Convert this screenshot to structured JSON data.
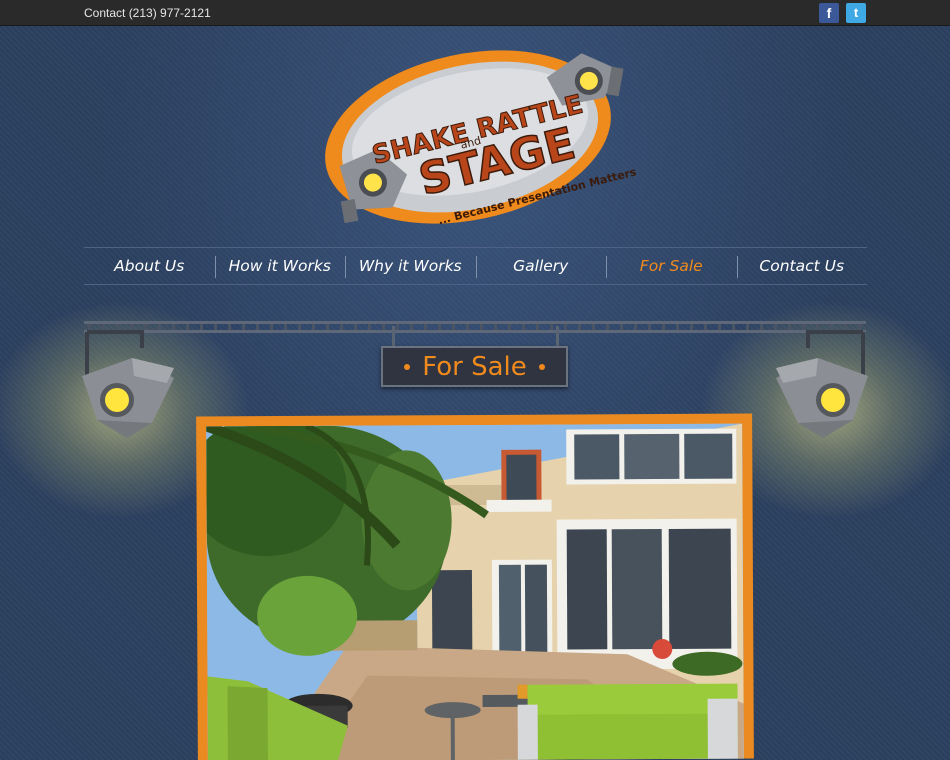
{
  "topbar": {
    "contact_text": "Contact (213) 977-2121",
    "facebook_label": "f",
    "twitter_label": "t"
  },
  "logo": {
    "line1": "SHAKE RATTLE",
    "and": "and",
    "line2": "STAGE",
    "tagline": "... Because Presentation Matters"
  },
  "nav": {
    "items": [
      {
        "label": "About Us"
      },
      {
        "label": "How it Works"
      },
      {
        "label": "Why it Works"
      },
      {
        "label": "Gallery"
      },
      {
        "label": "For Sale"
      },
      {
        "label": "Contact Us"
      }
    ],
    "active_index": 4
  },
  "sign": {
    "title": "For Sale"
  },
  "colors": {
    "background": "#2b3f5f",
    "accent": "#f08a1c",
    "topbar": "#2a2a2a",
    "facebook": "#3b5998",
    "twitter": "#3fa9e6"
  },
  "icons": {
    "facebook": "facebook-icon",
    "twitter": "twitter-icon",
    "spotlight": "spotlight-icon"
  }
}
